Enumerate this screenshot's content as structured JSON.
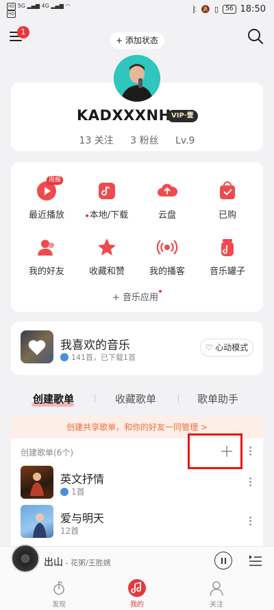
{
  "status_bar": {
    "sim1": "HD",
    "sim2": "HD",
    "net1": "5G",
    "net2": "4G",
    "battery": "56",
    "time": "18:50"
  },
  "header": {
    "menu_badge": "1",
    "add_status": "+ 添加状态"
  },
  "profile": {
    "username": "KADXXXNH",
    "vip_badge": "VIP·壹",
    "following": "13 关注",
    "followers": "3 粉丝",
    "level": "Lv.9"
  },
  "quick_grid": {
    "items": [
      {
        "label": "最近播放",
        "icon": "recent-play-icon",
        "tag": "周报"
      },
      {
        "label": "本地/下载",
        "icon": "local-download-icon"
      },
      {
        "label": "云盘",
        "icon": "cloud-disk-icon"
      },
      {
        "label": "已购",
        "icon": "purchased-icon"
      },
      {
        "label": "我的好友",
        "icon": "friends-icon"
      },
      {
        "label": "收藏和赞",
        "icon": "star-icon"
      },
      {
        "label": "我的播客",
        "icon": "podcast-icon"
      },
      {
        "label": "音乐罐子",
        "icon": "music-jar-icon"
      }
    ],
    "music_apps": "+ 音乐应用"
  },
  "liked": {
    "title": "我喜欢的音乐",
    "subtitle": "141首，已下载1首",
    "heart_mode": "心动模式"
  },
  "tabs": {
    "items": [
      "创建歌单",
      "收藏歌单",
      "歌单助手"
    ],
    "active": 0
  },
  "create_banner": "创建共享歌单，和你的好友一同管理 >",
  "playlists": {
    "header": "创建歌单(6个)",
    "items": [
      {
        "title": "英文抒情",
        "subtitle": "1首"
      },
      {
        "title": "爱与明天",
        "subtitle": "12首"
      }
    ]
  },
  "now_playing": {
    "title": "出山",
    "artist": " - 花粥/王胜娚"
  },
  "bottom_nav": {
    "items": [
      "发现",
      "我的",
      "关注"
    ],
    "active": 1
  },
  "colors": {
    "accent": "#e8373c",
    "highlight_box": "#ee1111"
  }
}
